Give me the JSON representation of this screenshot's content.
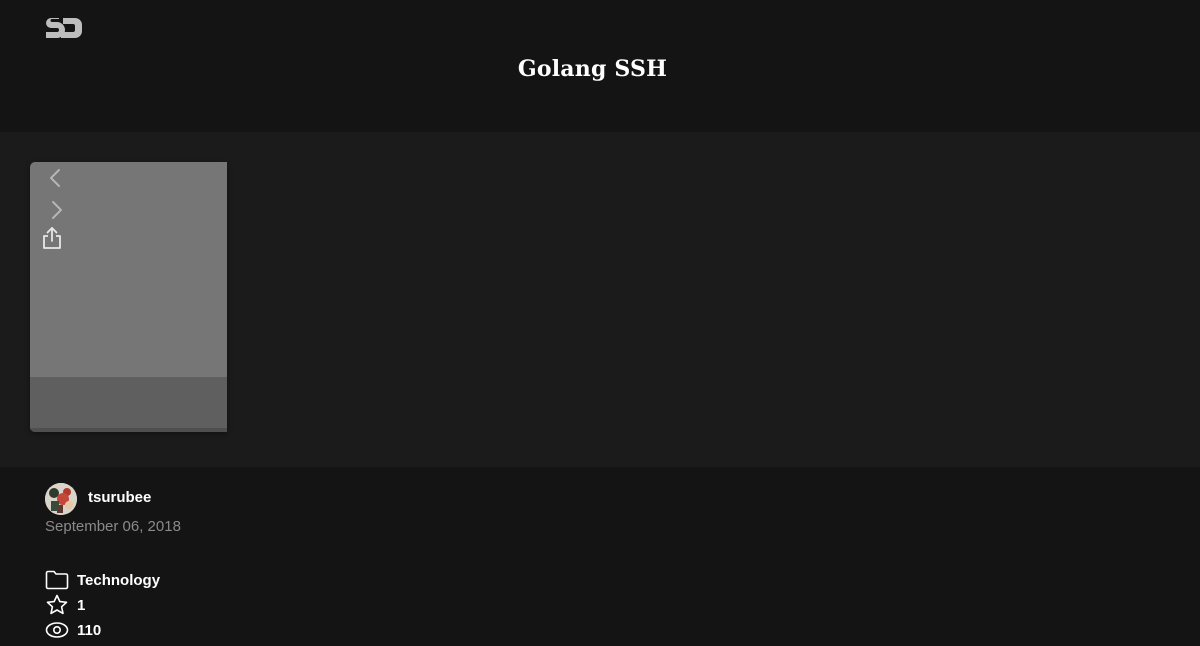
{
  "header": {
    "logo_icon": "speakerdeck-logo-icon",
    "title": "Golang SSH"
  },
  "viewer": {
    "prev_icon": "chevron-left-icon",
    "next_icon": "chevron-right-icon",
    "share_icon": "share-icon"
  },
  "author": {
    "name": "tsurubee",
    "avatar_icon": "avatar-image",
    "date": "September 06, 2018"
  },
  "stats": {
    "category": "Technology",
    "category_icon": "folder-icon",
    "stars": "1",
    "stars_icon": "star-icon",
    "views": "110",
    "views_icon": "eye-icon"
  },
  "colors": {
    "page_bg": "#141414",
    "player_bg": "#1b1b1b",
    "slide_bg": "#767676",
    "slide_footer": "#5f5f5f",
    "date_text": "#8a8a8a"
  }
}
